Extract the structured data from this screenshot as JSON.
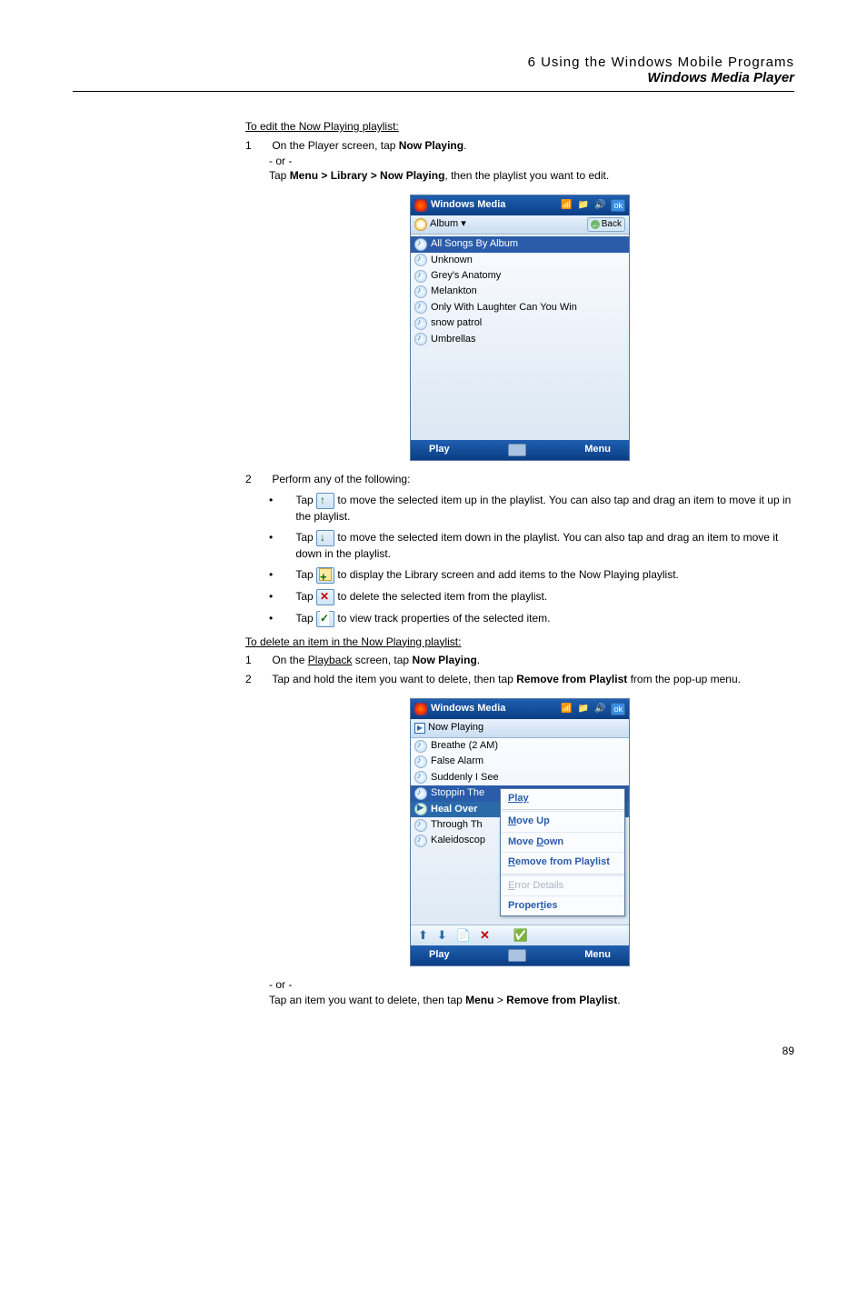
{
  "header": {
    "line1": "6 Using the Windows Mobile Programs",
    "line2": "Windows Media Player"
  },
  "section1_title": "To edit the Now Playing playlist:",
  "step1": {
    "num": "1",
    "text_a": "On the Player screen, tap ",
    "bold_a": "Now Playing",
    "tail_a": "."
  },
  "or": "- or -",
  "step1b": {
    "pre": "Tap ",
    "bold": "Menu > Library > Now Playing",
    "post": ", then the playlist you want to edit."
  },
  "shot1": {
    "title": "Windows Media",
    "ok": "ok",
    "sub_album": "Album",
    "back": "Back",
    "items": [
      "All Songs By Album",
      "Unknown",
      "Grey's Anatomy",
      "Melankton",
      "Only With Laughter Can You Win",
      "snow patrol",
      "Umbrellas"
    ],
    "foot_play": "Play",
    "foot_menu": "Menu"
  },
  "step2": {
    "num": "2",
    "text": "Perform any of the following:"
  },
  "bullets": {
    "up": {
      "pre": "Tap ",
      "post": " to move the selected item up in the playlist. You can also tap and drag an item to move it up in the playlist."
    },
    "down": {
      "pre": "Tap ",
      "post": " to move the selected item down in the playlist. You can also tap and drag an item to move it down in the playlist."
    },
    "lib": {
      "pre": "Tap ",
      "post": " to display the Library screen and add items to the Now Playing playlist."
    },
    "del": {
      "pre": "Tap ",
      "post": " to delete the selected item from the playlist."
    },
    "prop": {
      "pre": "Tap ",
      "post": " to view track properties of the selected item."
    }
  },
  "section2_title": "To delete an item in the Now Playing playlist:",
  "s2_step1": {
    "num": "1",
    "pre": "On the ",
    "link": "Playback",
    "post": " screen, tap ",
    "bold": "Now Playing",
    "tail": "."
  },
  "s2_step2": {
    "num": "2",
    "pre": "Tap and hold the item you want to delete, then tap ",
    "bold": "Remove from Playlist",
    "post": " from the pop-up menu."
  },
  "shot2": {
    "title": "Windows Media",
    "ok": "ok",
    "now_playing": "Now Playing",
    "rows": [
      "Breathe (2 AM)",
      "False Alarm",
      "Suddenly I See",
      "Stoppin The",
      "Heal Over",
      "Through Th",
      "Kaleidoscop"
    ],
    "menu": {
      "play": "Play",
      "moveup_u": "M",
      "moveup_r": "ove Up",
      "movedown_pre": "Move ",
      "movedown_u": "D",
      "movedown_post": "own",
      "remove_u": "R",
      "remove_r": "emove from Playlist",
      "error_u": "E",
      "error_r": "rror Details",
      "properties": "Properties",
      "properties_u": "t"
    },
    "foot_play": "Play",
    "foot_menu": "Menu"
  },
  "or2": "- or -",
  "tail": {
    "pre": "Tap an item you want to delete, then tap ",
    "b1": "Menu",
    "mid": " > ",
    "b2": "Remove from Playlist",
    "post": "."
  },
  "page_num": "89"
}
